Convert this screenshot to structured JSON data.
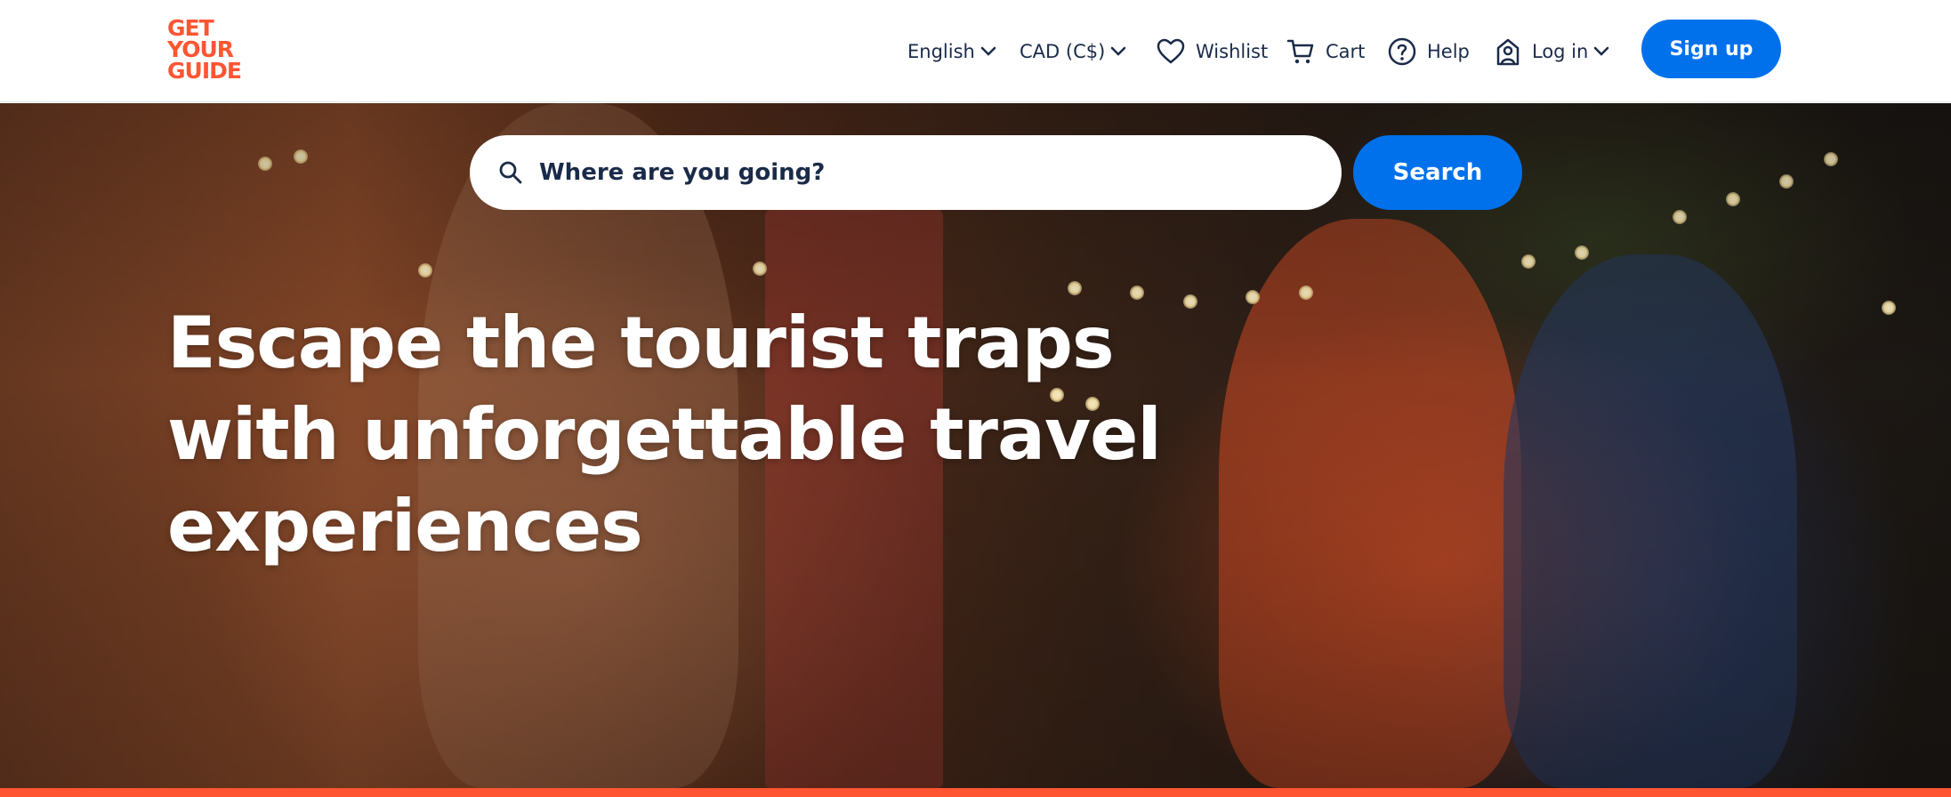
{
  "brand": {
    "logo_lines": [
      "GET",
      "YOUR",
      "GUIDE"
    ],
    "logo_color": "#ff5533",
    "accent_color": "#0071eb"
  },
  "header": {
    "language": "English",
    "currency": "CAD (C$)",
    "wishlist": "Wishlist",
    "cart": "Cart",
    "help": "Help",
    "login": "Log in",
    "signup": "Sign up"
  },
  "search": {
    "placeholder": "Where are you going?",
    "button": "Search"
  },
  "hero": {
    "headline_lines": [
      "Escape the tourist traps",
      "with unforgettable travel",
      "experiences"
    ]
  },
  "icons": [
    "chevron-down-icon",
    "heart-icon",
    "cart-icon",
    "help-icon",
    "user-icon",
    "search-icon"
  ]
}
